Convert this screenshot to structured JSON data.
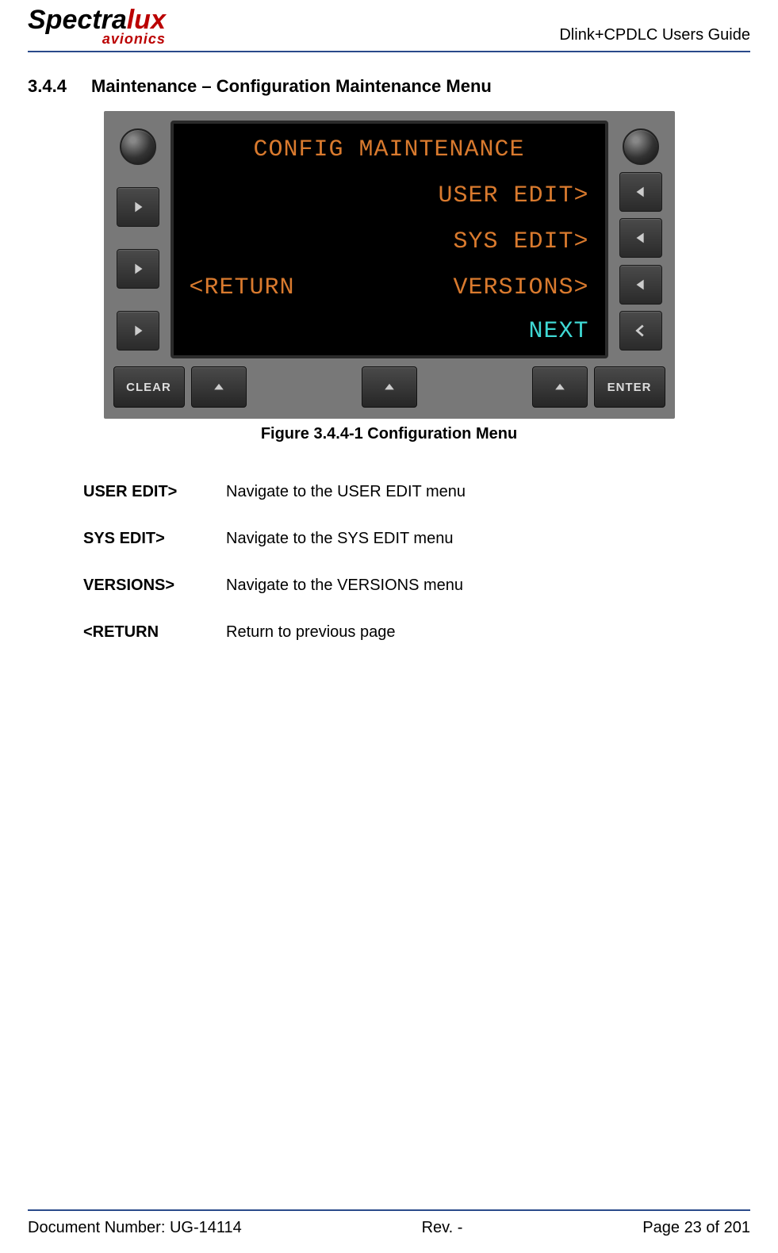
{
  "header": {
    "logo_spectra": "Spectra",
    "logo_lux": "lux",
    "logo_sub": "avionics",
    "guide_title": "Dlink+CPDLC Users Guide"
  },
  "section": {
    "number": "3.4.4",
    "title": "Maintenance – Configuration Maintenance Menu"
  },
  "screen": {
    "title": "CONFIG MAINTENANCE",
    "r1_right": "USER EDIT>",
    "r2_right": "SYS EDIT>",
    "r3_left": "<RETURN",
    "r3_right": "VERSIONS>",
    "r4_right": "NEXT"
  },
  "bottom_buttons": {
    "clear": "CLEAR",
    "enter": "ENTER"
  },
  "figure_caption": "Figure 3.4.4-1 Configuration Menu",
  "definitions": [
    {
      "term": "USER EDIT>",
      "def": "Navigate to the USER EDIT menu"
    },
    {
      "term": "SYS EDIT>",
      "def": "Navigate to the SYS EDIT menu"
    },
    {
      "term": "VERSIONS>",
      "def": "Navigate to the VERSIONS menu"
    },
    {
      "term": "<RETURN",
      "def": "Return to previous page"
    }
  ],
  "footer": {
    "doc": "Document Number:  UG-14114",
    "rev": "Rev. -",
    "page": "Page 23 of 201"
  }
}
